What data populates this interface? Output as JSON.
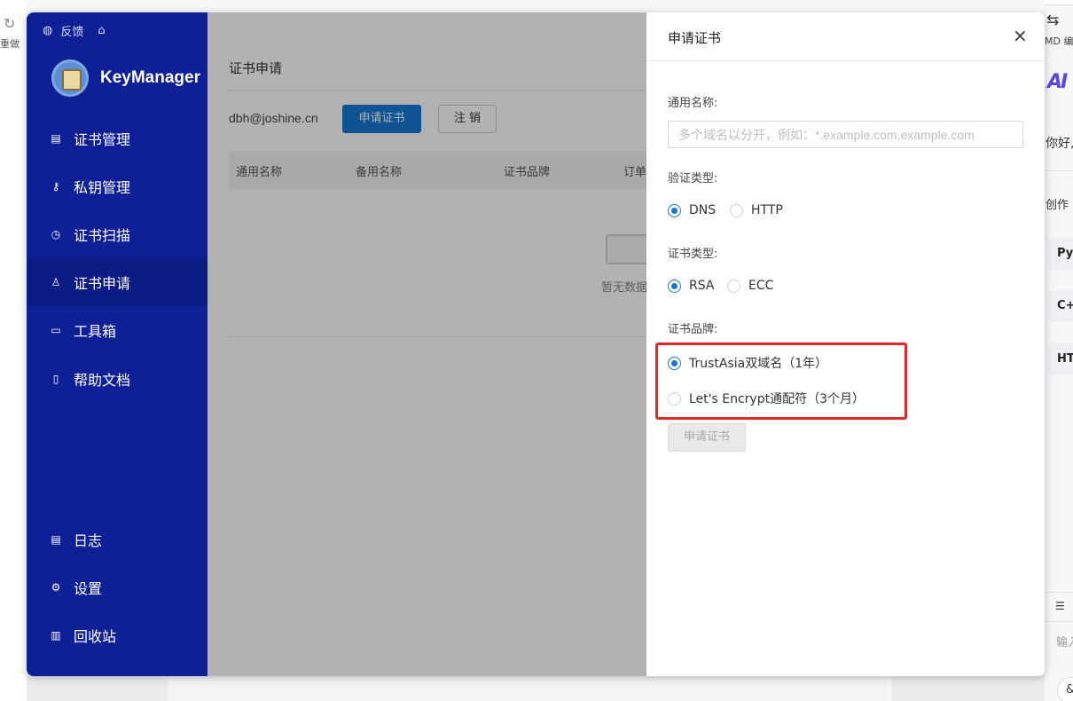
{
  "host": {
    "redo_label": "重做",
    "md_label": "MD 编辑",
    "ai_logo": "AI",
    "greeting": "你好,",
    "create": "创作",
    "chips": [
      "Py",
      "C+",
      "HT"
    ],
    "input_hint": "输入"
  },
  "sidebar": {
    "feedback": "反馈",
    "brand": "KeyManager",
    "items": [
      {
        "label": "证书管理",
        "icon": "certificate-icon"
      },
      {
        "label": "私钥管理",
        "icon": "key-icon"
      },
      {
        "label": "证书扫描",
        "icon": "scan-icon"
      },
      {
        "label": "证书申请",
        "icon": "user-icon"
      },
      {
        "label": "工具箱",
        "icon": "toolbox-icon"
      },
      {
        "label": "帮助文档",
        "icon": "document-icon"
      }
    ],
    "bottom_items": [
      {
        "label": "日志",
        "icon": "log-icon"
      },
      {
        "label": "设置",
        "icon": "settings-icon"
      },
      {
        "label": "回收站",
        "icon": "trash-icon"
      }
    ]
  },
  "main": {
    "title": "证书申请",
    "email": "dbh@joshine.cn",
    "apply_button": "申请证书",
    "logout_button": "注 销",
    "table_headers": [
      "通用名称",
      "备用名称",
      "证书品牌",
      "订单"
    ],
    "empty_text": "暂无数据"
  },
  "drawer": {
    "title": "申请证书",
    "close": "×",
    "common_name_label": "通用名称:",
    "common_name_placeholder": "多个域名以分开，例如：*.example.com,example.com",
    "validation_label": "验证类型:",
    "validation_options": [
      {
        "label": "DNS",
        "checked": true
      },
      {
        "label": "HTTP",
        "checked": false
      }
    ],
    "cert_type_label": "证书类型:",
    "cert_type_options": [
      {
        "label": "RSA",
        "checked": true
      },
      {
        "label": "ECC",
        "checked": false
      }
    ],
    "brand_label": "证书品牌:",
    "brand_options": [
      {
        "label": "TrustAsia双域名（1年）",
        "checked": true
      },
      {
        "label": "Let's Encrypt通配符（3个月）",
        "checked": false
      }
    ],
    "submit": "申请证书",
    "highlight_color": "#e02a2a",
    "accent_color": "#1677d2",
    "sidebar_color": "#0f1f96"
  }
}
